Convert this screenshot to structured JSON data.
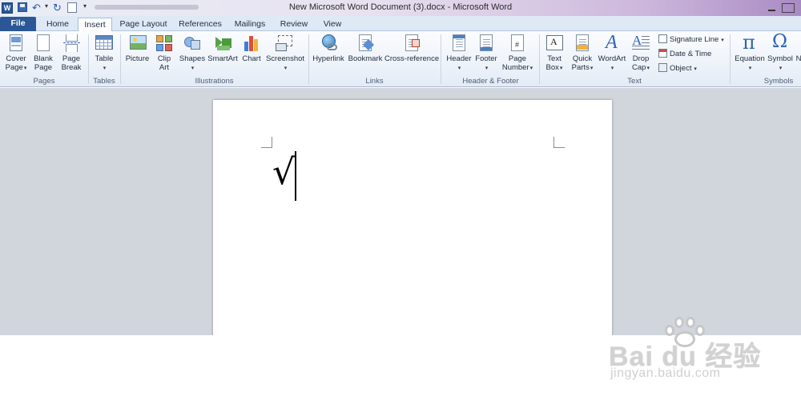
{
  "window": {
    "title": "New Microsoft Word Document (3).docx - Microsoft Word",
    "app_logo": "W"
  },
  "quick_access": {
    "icons": [
      "save-icon",
      "undo-icon",
      "redo-icon",
      "print-preview-icon",
      "customize-icon"
    ]
  },
  "tabs": [
    {
      "label": "File"
    },
    {
      "label": "Home"
    },
    {
      "label": "Insert",
      "active": true
    },
    {
      "label": "Page Layout"
    },
    {
      "label": "References"
    },
    {
      "label": "Mailings"
    },
    {
      "label": "Review"
    },
    {
      "label": "View"
    }
  ],
  "ribbon": {
    "pages": {
      "label": "Pages",
      "cover_page": "Cover\nPage",
      "blank_page": "Blank\nPage",
      "page_break": "Page\nBreak"
    },
    "tables": {
      "label": "Tables",
      "table": "Table"
    },
    "illustrations": {
      "label": "Illustrations",
      "picture": "Picture",
      "clip_art": "Clip\nArt",
      "shapes": "Shapes",
      "smartart": "SmartArt",
      "chart": "Chart",
      "screenshot": "Screenshot"
    },
    "links": {
      "label": "Links",
      "hyperlink": "Hyperlink",
      "bookmark": "Bookmark",
      "cross_reference": "Cross-reference"
    },
    "header_footer": {
      "label": "Header & Footer",
      "header": "Header",
      "footer": "Footer",
      "page_number": "Page\nNumber"
    },
    "text": {
      "label": "Text",
      "text_box": "Text\nBox",
      "quick_parts": "Quick\nParts",
      "wordart": "WordArt",
      "drop_cap": "Drop\nCap",
      "signature_line": "Signature Line",
      "date_time": "Date & Time",
      "object": "Object"
    },
    "symbols": {
      "label": "Symbols",
      "equation": "Equation",
      "symbol": "Symbol",
      "partial": "N"
    }
  },
  "document": {
    "text": "√"
  },
  "watermark": {
    "brand": "Bai du 经验",
    "url": "jingyan.baidu.com"
  },
  "colors": {
    "file_tab": "#2b5797",
    "ribbon_bg": "#eef3fa",
    "doc_background": "#d1d6dd"
  }
}
